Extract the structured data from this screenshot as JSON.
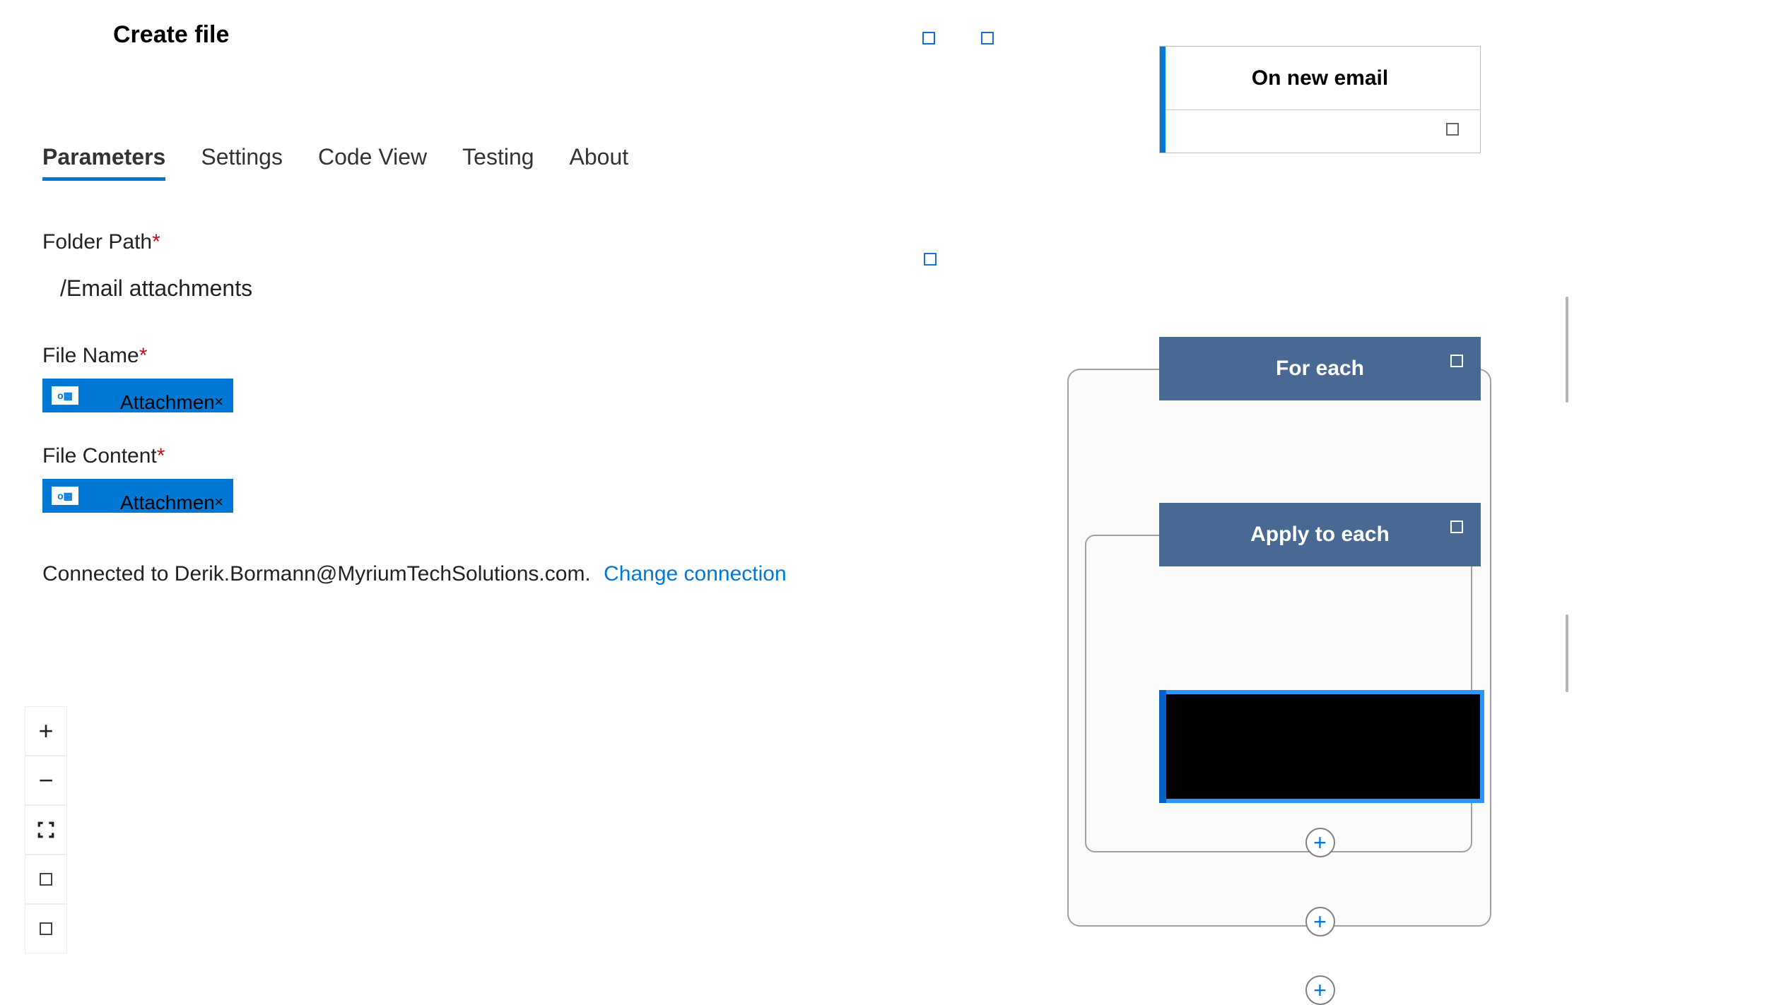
{
  "panel": {
    "title": "Create file",
    "tabs": [
      "Parameters",
      "Settings",
      "Code View",
      "Testing",
      "About"
    ],
    "active_tab": 0,
    "fields": {
      "folder_label": "Folder Path",
      "folder_value": "/Email attachments",
      "filename_label": "File Name",
      "filename_token": "Attachmen",
      "filecontent_label": "File Content",
      "filecontent_token": "Attachmen"
    },
    "connection": {
      "prefix": "Connected to ",
      "email": "Derik.Bormann@MyriumTechSolutions.com.",
      "change_link": "Change connection"
    }
  },
  "flow": {
    "trigger_title": "On new email",
    "for_each_title": "For each",
    "apply_each_title": "Apply to each"
  },
  "toolbar": {
    "plus": "+",
    "minus": "−"
  }
}
